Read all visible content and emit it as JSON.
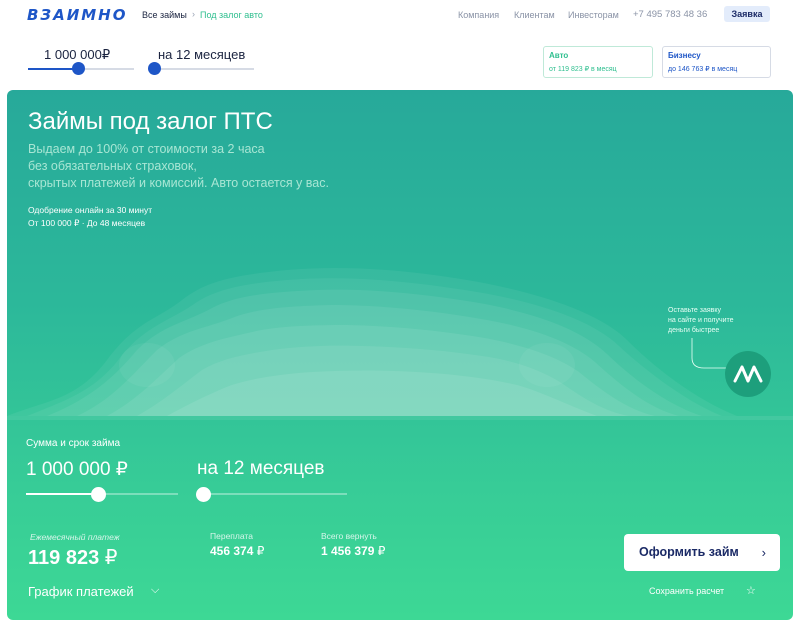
{
  "header": {
    "logo": "ВЗАИМНО",
    "breadcrumb": {
      "all": "Все займы",
      "separator": "›",
      "current": "Под залог авто"
    },
    "nav": [
      "Компания",
      "Клиентам",
      "Инвесторам"
    ],
    "phone": "+7 495 783 48 36",
    "apply_label": "Заявка"
  },
  "mini_calc": {
    "amount": "1 000 000₽",
    "term": "на 12 месяцев",
    "amount_slider_fraction": 0.47,
    "term_slider_fraction": 0.0
  },
  "cards": {
    "auto": {
      "title": "Авто",
      "subtitle": "от 119 823 ₽ в месяц"
    },
    "business": {
      "title": "Бизнесу",
      "subtitle": "до 146 763 ₽ в месяц"
    }
  },
  "hero": {
    "title": "Займы под залог ПТС",
    "description": [
      "Выдаем до 100% от стоимости за 2  часа",
      "без обязательных страховок,",
      "скрытых платежей и комиссий. Авто остается у вас."
    ],
    "note1": "Одобрение онлайн за 30 минут",
    "note2": "От 100 000 ₽ · До 48 месяцев",
    "promo": [
      "Оставьте заявку",
      "на сайте и получите",
      "деньги быстрее"
    ]
  },
  "calculator": {
    "label": "Сумма и срок займа",
    "amount": "1 000 000 ₽",
    "term": "на 12 месяцев",
    "amount_slider_fraction": 0.48,
    "term_slider_fraction": 0.0,
    "monthly_label": "Ежемесячный платеж",
    "monthly_value": "119 823",
    "monthly_currency": "₽",
    "overpay_label": "Переплата",
    "overpay_value": "456 374",
    "total_label": "Всего вернуть",
    "total_value": "1 456 379",
    "currency": "₽",
    "schedule_label": "График платежей",
    "submit_label": "Оформить займ",
    "save_label": "Сохранить расчет"
  },
  "colors": {
    "brand_blue": "#1e56c7",
    "accent_green": "#2fbf8f",
    "hero_top": "#27a99a",
    "hero_bottom": "#3dd895"
  }
}
